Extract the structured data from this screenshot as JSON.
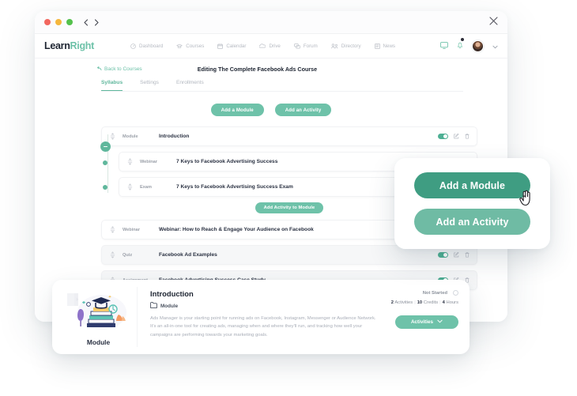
{
  "window": {
    "traffic_lights": [
      "red",
      "yellow",
      "green"
    ],
    "back_icon": "chevron-left-icon",
    "forward_icon": "chevron-right-icon",
    "close_icon": "close-icon"
  },
  "brand": {
    "name_part1": "Learn",
    "name_part2": "Right",
    "accent": "#6ec2a9"
  },
  "nav": {
    "items": [
      {
        "label": "Dashboard",
        "icon": "dashboard-icon"
      },
      {
        "label": "Courses",
        "icon": "courses-icon"
      },
      {
        "label": "Calendar",
        "icon": "calendar-icon"
      },
      {
        "label": "Drive",
        "icon": "drive-icon"
      },
      {
        "label": "Forum",
        "icon": "forum-icon"
      },
      {
        "label": "Directory",
        "icon": "directory-icon"
      },
      {
        "label": "News",
        "icon": "news-icon"
      }
    ],
    "right": {
      "chat_icon": "chat-icon",
      "bell_icon": "bell-icon",
      "avatar": "user-avatar",
      "chevron": "chevron-down-icon"
    }
  },
  "page": {
    "back_link": "Back to Courses",
    "title": "Editing The Complete Facebook Ads Course",
    "tabs": [
      {
        "label": "Syllabus",
        "active": true
      },
      {
        "label": "Settings",
        "active": false
      },
      {
        "label": "Enrollments",
        "active": false
      }
    ],
    "actions": {
      "add_module": "Add a Module",
      "add_activity": "Add an Activity",
      "add_activity_to_module": "Add Activity to Module"
    }
  },
  "syllabus": {
    "rows": [
      {
        "kind": "Module",
        "title": "Introduction",
        "child": false,
        "shaded": false,
        "toggle": true
      },
      {
        "kind": "Webinar",
        "title": "7 Keys to Facebook Advertising Success",
        "child": true,
        "shaded": false,
        "toggle": true
      },
      {
        "kind": "Exam",
        "title": "7 Keys to Facebook Advertising Success Exam",
        "child": true,
        "shaded": false,
        "toggle": true
      },
      {
        "kind": "Webinar",
        "title": "Webinar: How to Reach & Engage Your Audience on Facebook",
        "child": false,
        "shaded": false,
        "toggle": true
      },
      {
        "kind": "Quiz",
        "title": "Facebook Ad Examples",
        "child": false,
        "shaded": true,
        "toggle": true
      },
      {
        "kind": "Assignment",
        "title": "Facebook Advertising Success Case Study",
        "child": false,
        "shaded": true,
        "toggle": true
      }
    ]
  },
  "popup": {
    "add_module": "Add a Module",
    "add_activity": "Add an Activity",
    "primary_color": "#3f9d82",
    "secondary_color": "#6fbba4",
    "cursor": "hand-pointer-cursor"
  },
  "detail": {
    "thumb_label": "Module",
    "thumb_icon": "module-illustration",
    "title": "Introduction",
    "kind_icon": "folder-icon",
    "kind": "Module",
    "description": "Ads Manager is your starting point for running ads on Facebook, Instagram, Messenger or Audience Network. It's an all-in-one tool for creating ads, managing when and where they'll run, and tracking how well your campaigns are performing towards your marketing goals.",
    "status": "Not Started",
    "status_icon": "progress-circle-icon",
    "stats": {
      "activities": "2",
      "activities_label": "Activities",
      "credits": "10",
      "credits_label": "Credits",
      "hours": "4",
      "hours_label": "Hours"
    },
    "activities_button": "Activities",
    "activities_chevron": "chevron-down-icon"
  }
}
